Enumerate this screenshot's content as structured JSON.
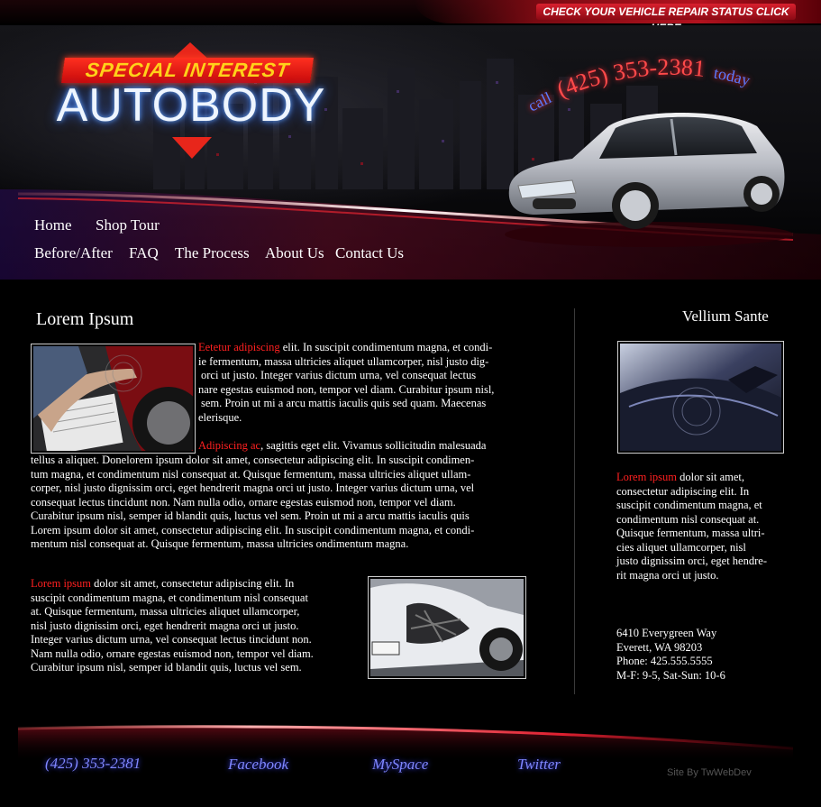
{
  "header": {
    "repair_status_link": "CHECK YOUR VEHICLE REPAIR STATUS CLICK HERE",
    "logo_top": "SPECIAL INTEREST",
    "logo_main": "AUTOBODY",
    "call_prefix": "call",
    "call_phone": "(425) 353-2381",
    "call_suffix": "today"
  },
  "nav": {
    "items": [
      "Home",
      "Shop Tour",
      "Before/After",
      "FAQ",
      "The Process",
      "About Us",
      "Contact Us"
    ]
  },
  "main": {
    "title": "Lorem Ipsum",
    "para1_lead": "Eetetur adipiscing",
    "para1_lines": [
      "elit. In suscipit condimentum magna, et condi-",
      "ie fermentum, massa ultricies aliquet ullamcorper, nisl justo dig-",
      "orci ut justo. Integer varius dictum urna, vel consequat lectus",
      "nare egestas euismod non, tempor vel diam. Curabitur ipsum nisl,",
      "sem. Proin ut mi a arcu mattis iaculis quis sed quam. Maecenas",
      "elerisque."
    ],
    "para2_lead": "Adipiscing ac",
    "para2_first": ", sagittis eget elit. Vivamus sollicitudin malesuada",
    "para2_lines": [
      "tellus a aliquet. Donelorem ipsum dolor sit amet, consectetur adipiscing elit. In suscipit condimen-",
      "tum magna, et condimentum nisl consequat at. Quisque fermentum, massa ultricies aliquet ullam-",
      "corper, nisl justo dignissim orci, eget hendrerit magna orci ut justo. Integer varius dictum urna, vel",
      "consequat lectus tincidunt non. Nam nulla odio, ornare egestas euismod non, tempor vel diam.",
      "Curabitur ipsum nisl, semper id blandit quis, luctus vel sem. Proin ut mi a arcu mattis iaculis quis",
      "Lorem ipsum dolor sit amet, consectetur adipiscing elit. In suscipit condimentum magna, et condi-",
      "mentum nisl consequat at. Quisque fermentum, massa ultricies ondimentum magna."
    ],
    "para3_lead": "Lorem ipsum",
    "para3_first": " dolor sit amet, consectetur adipiscing elit. In",
    "para3_lines": [
      "suscipit condimentum magna, et condimentum nisl consequat",
      "at. Quisque fermentum, massa ultricies aliquet ullamcorper,",
      "nisl justo dignissim orci, eget hendrerit magna orci ut justo.",
      "Integer varius dictum urna, vel consequat lectus tincidunt non.",
      "Nam nulla odio, ornare egestas euismod non, tempor vel diam.",
      "Curabitur ipsum nisl, semper id blandit quis, luctus vel sem."
    ]
  },
  "sidebar": {
    "title": "Vellium Sante",
    "lead": "Lorem ipsum",
    "first": " dolor sit amet,",
    "lines": [
      "consectetur adipiscing elit. In",
      "suscipit condimentum magna, et",
      "condimentum nisl consequat at.",
      "Quisque fermentum, massa ultri-",
      "cies aliquet ullamcorper, nisl",
      "justo dignissim orci, eget hendre-",
      "rit magna orci ut justo."
    ],
    "address": [
      "6410 Everygreen Way",
      "Everett, WA 98203",
      "Phone: 425.555.5555",
      "M-F: 9-5, Sat-Sun: 10-6"
    ]
  },
  "footer": {
    "phone": "(425) 353-2381",
    "links": [
      "Facebook",
      "MySpace",
      "Twitter"
    ],
    "credit": "Site By TwWebDev"
  },
  "colors": {
    "accent_red": "#ff2020",
    "footer_link": "#7f86ff",
    "background": "#000000"
  }
}
